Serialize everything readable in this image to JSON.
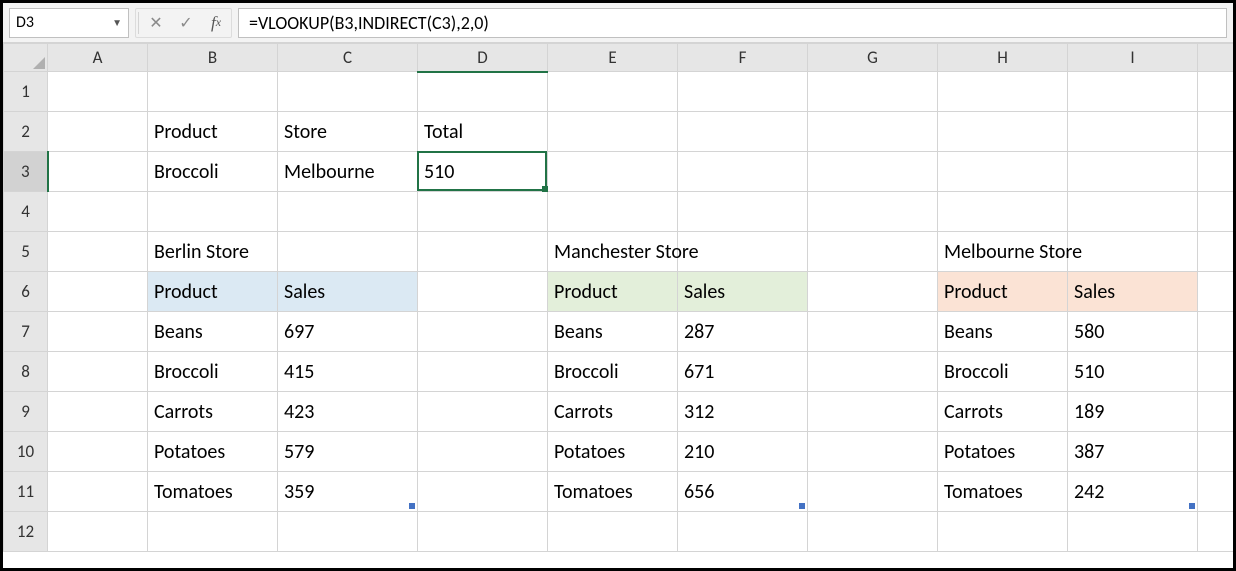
{
  "formula_bar": {
    "cell_ref": "D3",
    "formula": "=VLOOKUP(B3,INDIRECT(C3),2,0)"
  },
  "columns": [
    "A",
    "B",
    "C",
    "D",
    "E",
    "F",
    "G",
    "H",
    "I"
  ],
  "rows": [
    "1",
    "2",
    "3",
    "4",
    "5",
    "6",
    "7",
    "8",
    "9",
    "10",
    "11",
    "12"
  ],
  "active": {
    "col": "D",
    "row": "3"
  },
  "lookup": {
    "header_product": "Product",
    "header_store": "Store",
    "header_total": "Total",
    "product": "Broccoli",
    "store": "Melbourne",
    "total": "510"
  },
  "stores": {
    "berlin": {
      "title": "Berlin Store",
      "h1": "Product",
      "h2": "Sales",
      "rows": [
        {
          "p": "Beans",
          "s": "697"
        },
        {
          "p": "Broccoli",
          "s": "415"
        },
        {
          "p": "Carrots",
          "s": "423"
        },
        {
          "p": "Potatoes",
          "s": "579"
        },
        {
          "p": "Tomatoes",
          "s": "359"
        }
      ]
    },
    "manchester": {
      "title": "Manchester Store",
      "h1": "Product",
      "h2": "Sales",
      "rows": [
        {
          "p": "Beans",
          "s": "287"
        },
        {
          "p": "Broccoli",
          "s": "671"
        },
        {
          "p": "Carrots",
          "s": "312"
        },
        {
          "p": "Potatoes",
          "s": "210"
        },
        {
          "p": "Tomatoes",
          "s": "656"
        }
      ]
    },
    "melbourne": {
      "title": "Melbourne Store",
      "h1": "Product",
      "h2": "Sales",
      "rows": [
        {
          "p": "Beans",
          "s": "580"
        },
        {
          "p": "Broccoli",
          "s": "510"
        },
        {
          "p": "Carrots",
          "s": "189"
        },
        {
          "p": "Potatoes",
          "s": "387"
        },
        {
          "p": "Tomatoes",
          "s": "242"
        }
      ]
    }
  }
}
